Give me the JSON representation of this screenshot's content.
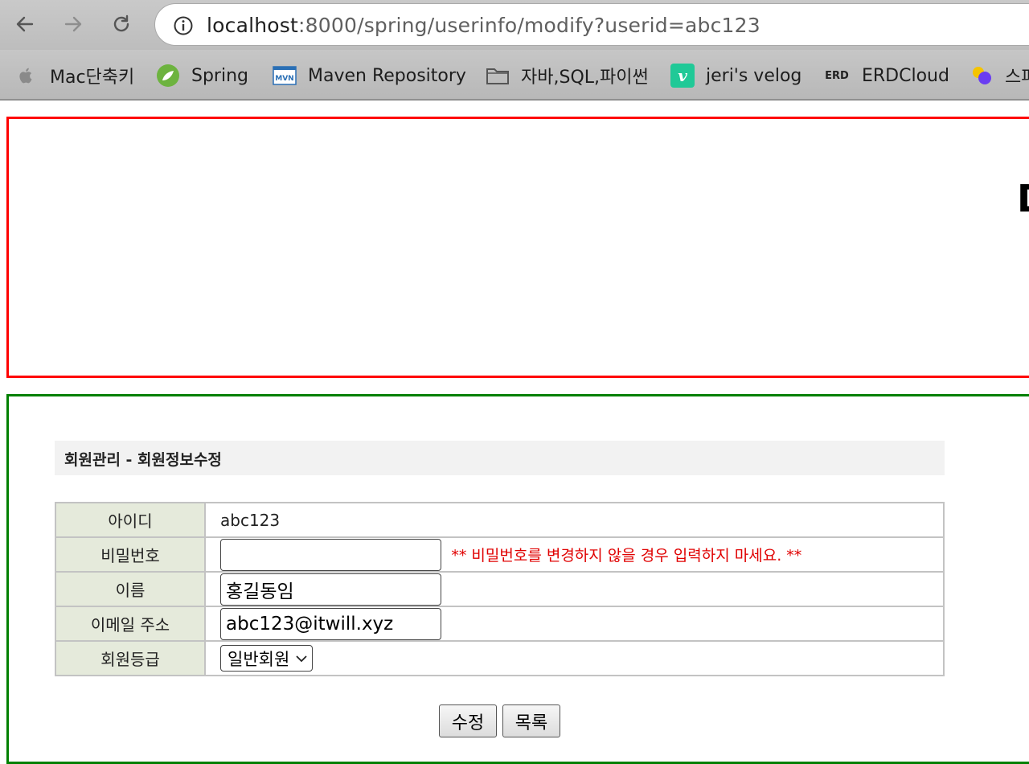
{
  "browser": {
    "url_host": "localhost",
    "url_path": ":8000/spring/userinfo/modify?userid=abc123",
    "bookmarks": [
      {
        "label": "Mac단축키",
        "icon": "apple-icon"
      },
      {
        "label": "Spring",
        "icon": "spring-leaf-icon"
      },
      {
        "label": "Maven Repository",
        "icon": "maven-icon"
      },
      {
        "label": "자바,SQL,파이썬",
        "icon": "folder-icon"
      },
      {
        "label": "jeri's velog",
        "icon": "velog-icon"
      },
      {
        "label": "ERDCloud",
        "icon": "erd-icon"
      },
      {
        "label": "스파",
        "icon": "colorful-dots-icon"
      }
    ],
    "erd_icon_text": "ERD",
    "velog_icon_text": "v"
  },
  "header": {
    "glyph": "D"
  },
  "page": {
    "title": "회원관리 - 회원정보수정",
    "rows": {
      "id_label": "아이디",
      "id_value": "abc123",
      "password_label": "비밀번호",
      "password_value": "",
      "password_note": "** 비밀번호를 변경하지 않을 경우 입력하지 마세요. **",
      "name_label": "이름",
      "name_value": "홍길동임",
      "email_label": "이메일 주소",
      "email_value": "abc123@itwill.xyz",
      "grade_label": "회원등급",
      "grade_selected": "일반회원"
    },
    "buttons": {
      "modify": "수정",
      "list": "목록"
    }
  },
  "colors": {
    "header_border": "#ff0000",
    "content_border": "#008000",
    "note_text": "#e00000",
    "label_bg": "#e5eadb"
  }
}
